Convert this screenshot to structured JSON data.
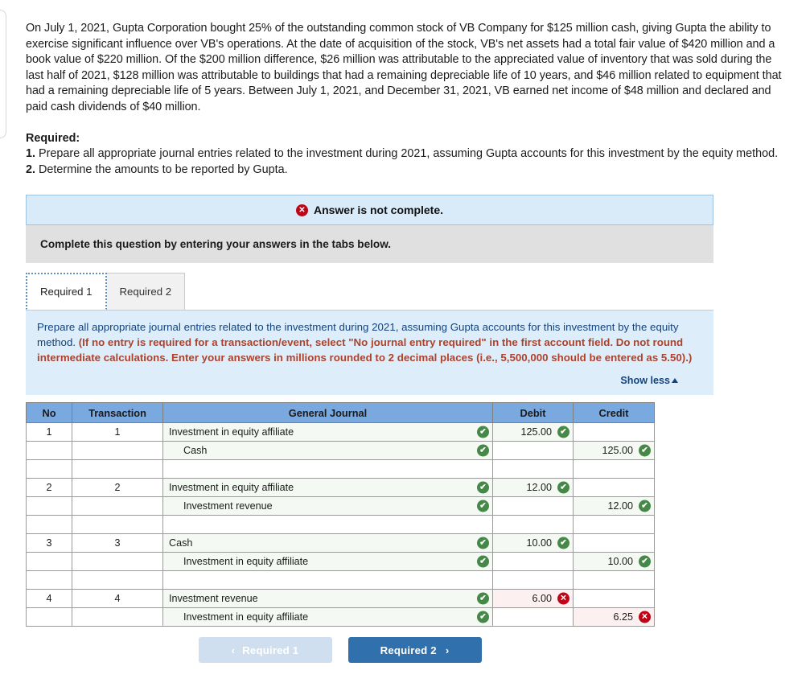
{
  "narrative": "On July 1, 2021, Gupta Corporation bought 25% of the outstanding common stock of VB Company for $125 million cash, giving Gupta the ability to exercise significant influence over VB's operations. At the date of acquisition of the stock, VB's net assets had a total fair value of $420 million and a book value of $220 million. Of the $200 million difference, $26 million was attributable to the appreciated value of inventory that was sold during the last half of 2021, $128 million was attributable to buildings that had a remaining depreciable life of 10 years, and $46 million related to equipment that had a remaining depreciable life of 5 years. Between July 1, 2021, and December 31, 2021, VB earned net income of $48 million and declared and paid cash dividends of $40 million.",
  "required": {
    "heading": "Required:",
    "item1_num": "1.",
    "item1_text": " Prepare all appropriate journal entries related to the investment during 2021, assuming Gupta accounts for this investment by the equity method.",
    "item2_num": "2.",
    "item2_text": " Determine the amounts to be reported by Gupta."
  },
  "alert": {
    "icon": "error-circle-icon",
    "glyph": "✕",
    "text": "Answer is not complete.",
    "bg_color": "#d9ebf9",
    "border_color": "#9dc3e0",
    "icon_color": "#c00418"
  },
  "gray_bar": {
    "text": "Complete this question by entering your answers in the tabs below."
  },
  "tabs": [
    {
      "label": "Required 1",
      "active": true
    },
    {
      "label": "Required 2",
      "active": false
    }
  ],
  "instruction_panel": {
    "lead": "Prepare all appropriate journal entries related to the investment during 2021, assuming Gupta accounts for this investment by the equity method. ",
    "paren": "(If no entry is required for a transaction/event, select \"No journal entry required\" in the first account field. Do not round intermediate calculations. Enter your answers in millions rounded to 2 decimal places (i.e., 5,500,000 should be entered as 5.50).)",
    "show_less_label": "Show less",
    "show_less_icon": "triangle-up-icon"
  },
  "table": {
    "headers": [
      "No",
      "Transaction",
      "General Journal",
      "Debit",
      "Credit"
    ],
    "header_bg": "#79a9de",
    "rows": [
      {
        "kind": "entry",
        "no": "1",
        "transaction": "1",
        "account": "Investment in equity affiliate",
        "indent": false,
        "account_status": "good",
        "debit": "125.00",
        "debit_status": "good",
        "credit": "",
        "credit_status": ""
      },
      {
        "kind": "entry",
        "no": "",
        "transaction": "",
        "account": "Cash",
        "indent": true,
        "account_status": "good",
        "debit": "",
        "debit_status": "",
        "credit": "125.00",
        "credit_status": "good"
      },
      {
        "kind": "spacer"
      },
      {
        "kind": "entry",
        "no": "2",
        "transaction": "2",
        "account": "Investment in equity affiliate",
        "indent": false,
        "account_status": "good",
        "debit": "12.00",
        "debit_status": "good",
        "credit": "",
        "credit_status": ""
      },
      {
        "kind": "entry",
        "no": "",
        "transaction": "",
        "account": "Investment revenue",
        "indent": true,
        "account_status": "good",
        "debit": "",
        "debit_status": "",
        "credit": "12.00",
        "credit_status": "good"
      },
      {
        "kind": "spacer"
      },
      {
        "kind": "entry",
        "no": "3",
        "transaction": "3",
        "account": "Cash",
        "indent": false,
        "account_status": "good",
        "debit": "10.00",
        "debit_status": "good",
        "credit": "",
        "credit_status": ""
      },
      {
        "kind": "entry",
        "no": "",
        "transaction": "",
        "account": "Investment in equity affiliate",
        "indent": true,
        "account_status": "good",
        "debit": "",
        "debit_status": "",
        "credit": "10.00",
        "credit_status": "good"
      },
      {
        "kind": "spacer"
      },
      {
        "kind": "entry",
        "no": "4",
        "transaction": "4",
        "account": "Investment revenue",
        "indent": false,
        "account_status": "good",
        "debit": "6.00",
        "debit_status": "bad",
        "credit": "",
        "credit_status": ""
      },
      {
        "kind": "entry",
        "no": "",
        "transaction": "",
        "account": "Investment in equity affiliate",
        "indent": true,
        "account_status": "good",
        "debit": "",
        "debit_status": "",
        "credit": "6.25",
        "credit_status": "bad"
      }
    ],
    "status_glyphs": {
      "good": "✔",
      "bad": "✕"
    },
    "good_color": "#468847",
    "bad_color": "#c00418"
  },
  "footer": {
    "prev_label": "Required 1",
    "prev_icon": "chevron-left-icon",
    "prev_glyph": "‹",
    "next_label": "Required 2",
    "next_icon": "chevron-right-icon",
    "next_glyph": "›",
    "next_bg": "#3071ad",
    "prev_bg": "#cfdff0"
  }
}
